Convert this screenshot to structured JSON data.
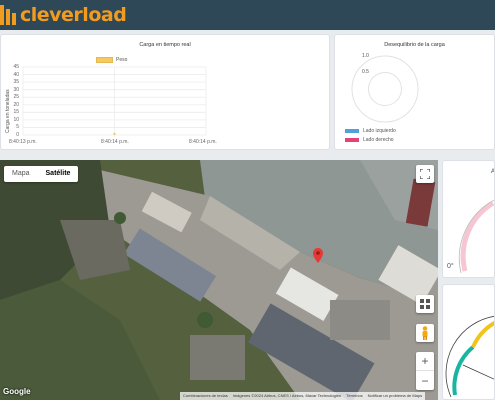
{
  "header": {
    "brand": "cleverload"
  },
  "load_chart": {
    "title": "Carga en tiempo real",
    "legend_label": "Peso",
    "ylabel": "Carga en toneladas",
    "yticks": [
      "45",
      "40",
      "35",
      "30",
      "25",
      "20",
      "15",
      "10",
      "5",
      "0"
    ],
    "xticks": [
      "8:40:13 p.m.",
      "8:40:14 p.m.",
      "8:40:14 p.m."
    ]
  },
  "chart_data": [
    {
      "type": "line",
      "title": "Carga en tiempo real",
      "xlabel": "",
      "ylabel": "Carga en toneladas",
      "ylim": [
        0,
        45
      ],
      "x": [
        "8:40:13 p.m.",
        "8:40:14 p.m.",
        "8:40:14 p.m."
      ],
      "series": [
        {
          "name": "Peso",
          "values": [
            0,
            0,
            0
          ],
          "color": "#f6c85f"
        }
      ],
      "legend": "top",
      "grid": true
    },
    {
      "type": "radar",
      "title": "Desequilibrio de la carga",
      "rlim": [
        0,
        1
      ],
      "rticks": [
        "1.0",
        "0.5"
      ],
      "series": [
        {
          "name": "Lado izquierdo",
          "color": "#4ea1d9"
        },
        {
          "name": "Lado derecho",
          "color": "#e4407a"
        }
      ],
      "legend": "bottom-left"
    }
  ],
  "balance_chart": {
    "title": "Desequilibrio de la carga",
    "rticks": [
      "1.0",
      "0.5"
    ],
    "legend": [
      {
        "label": "Lado izquierdo",
        "color": "#4ea1d9"
      },
      {
        "label": "Lado derecho",
        "color": "#e4407a"
      }
    ]
  },
  "map": {
    "tabs": [
      "Mapa",
      "Satélite"
    ],
    "active_tab": "Satélite",
    "zoom_in": "+",
    "zoom_out": "−",
    "google": "Google",
    "attribution": [
      "Combinaciones de teclas",
      "Imágenes ©2024 Airbus, CNES / Airbus, Maxar Technologies",
      "Términos",
      "Notificar un problema de Maps"
    ],
    "icons": [
      "fullscreen-icon",
      "layers-icon",
      "pegman-icon",
      "map-marker-icon"
    ]
  },
  "gauges": {
    "g1_title": "A",
    "g1_zero": "0°"
  },
  "colors": {
    "header": "#2f4858",
    "brand": "#f29c1f",
    "peso": "#f6c85f",
    "left": "#4ea1d9",
    "right": "#e4407a"
  }
}
